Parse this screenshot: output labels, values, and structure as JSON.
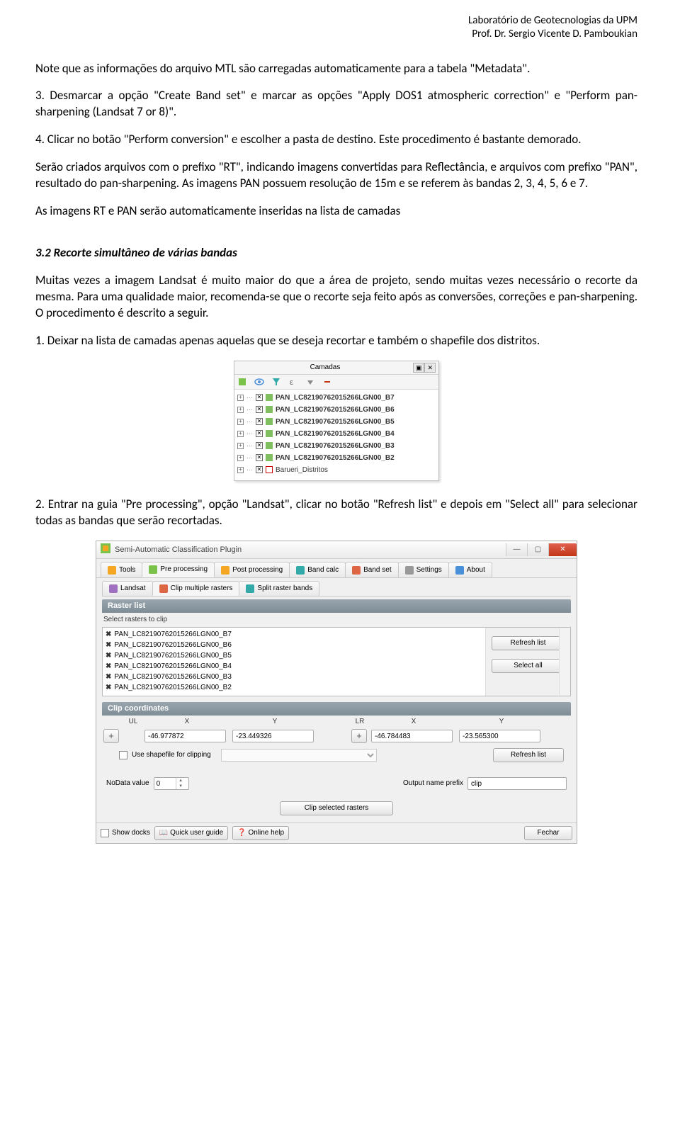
{
  "header": {
    "line1": "Laboratório de Geotecnologias da UPM",
    "line2": "Prof. Dr. Sergio Vicente D. Pamboukian"
  },
  "paragraphs": {
    "p1": "Note que as informações do arquivo MTL são carregadas automaticamente para a tabela \"Metadata\".",
    "p2": "3. Desmarcar a opção \"Create Band set\" e marcar as opções \"Apply DOS1 atmospheric correction\" e \"Perform pan-sharpening (Landsat 7 or 8)\".",
    "p3": "4. Clicar no botão \"Perform conversion\" e escolher a pasta de destino. Este procedimento é bastante demorado.",
    "p4": "Serão criados arquivos com o prefixo \"RT\", indicando imagens convertidas para Reflectância, e arquivos com prefixo \"PAN\", resultado do pan-sharpening. As imagens PAN possuem resolução de 15m e se referem às bandas 2, 3, 4, 5, 6 e 7.",
    "p5": "As imagens RT e PAN serão automaticamente inseridas na lista de camadas",
    "section": "3.2 Recorte simultâneo de várias bandas",
    "p6": "Muitas vezes a imagem Landsat é muito maior do que a área de projeto, sendo muitas vezes necessário o recorte da mesma. Para uma qualidade maior, recomenda-se que o recorte seja feito após as conversões, correções e pan-sharpening. O procedimento é descrito a seguir.",
    "p7": "1. Deixar na lista de camadas apenas aquelas que se deseja recortar e também o shapefile dos distritos.",
    "p8": "2. Entrar na guia \"Pre processing\", opção \"Landsat\", clicar no botão \"Refresh list\" e depois em \"Select all\" para selecionar todas as bandas que serão recortadas."
  },
  "camadas": {
    "title": "Camadas",
    "layers": [
      "PAN_LC82190762015266LGN00_B7",
      "PAN_LC82190762015266LGN00_B6",
      "PAN_LC82190762015266LGN00_B5",
      "PAN_LC82190762015266LGN00_B4",
      "PAN_LC82190762015266LGN00_B3",
      "PAN_LC82190762015266LGN00_B2"
    ],
    "shapefile": "Barueri_Distritos"
  },
  "scp": {
    "title": "Semi-Automatic Classification Plugin",
    "tabs": [
      "Tools",
      "Pre processing",
      "Post processing",
      "Band calc",
      "Band set",
      "Settings",
      "About"
    ],
    "subtabs": [
      "Landsat",
      "Clip multiple rasters",
      "Split raster bands"
    ],
    "raster_list_label": "Raster list",
    "select_rasters_label": "Select rasters to clip",
    "rasters": [
      "PAN_LC82190762015266LGN00_B7",
      "PAN_LC82190762015266LGN00_B6",
      "PAN_LC82190762015266LGN00_B5",
      "PAN_LC82190762015266LGN00_B4",
      "PAN_LC82190762015266LGN00_B3",
      "PAN_LC82190762015266LGN00_B2"
    ],
    "btn_refresh": "Refresh list",
    "btn_select_all": "Select all",
    "clip_label": "Clip coordinates",
    "ul": "UL",
    "lr": "LR",
    "x": "X",
    "y": "Y",
    "ul_x": "-46.977872",
    "ul_y": "-23.449326",
    "lr_x": "-46.784483",
    "lr_y": "-23.565300",
    "shapefile_clip": "Use shapefile for clipping",
    "nodata_label": "NoData value",
    "nodata_value": "0",
    "output_prefix_label": "Output name prefix",
    "output_prefix_value": "clip",
    "btn_clip": "Clip selected rasters",
    "status": {
      "show_docks": "Show docks",
      "quick_guide": "Quick user guide",
      "online_help": "Online help",
      "fechar": "Fechar"
    }
  }
}
